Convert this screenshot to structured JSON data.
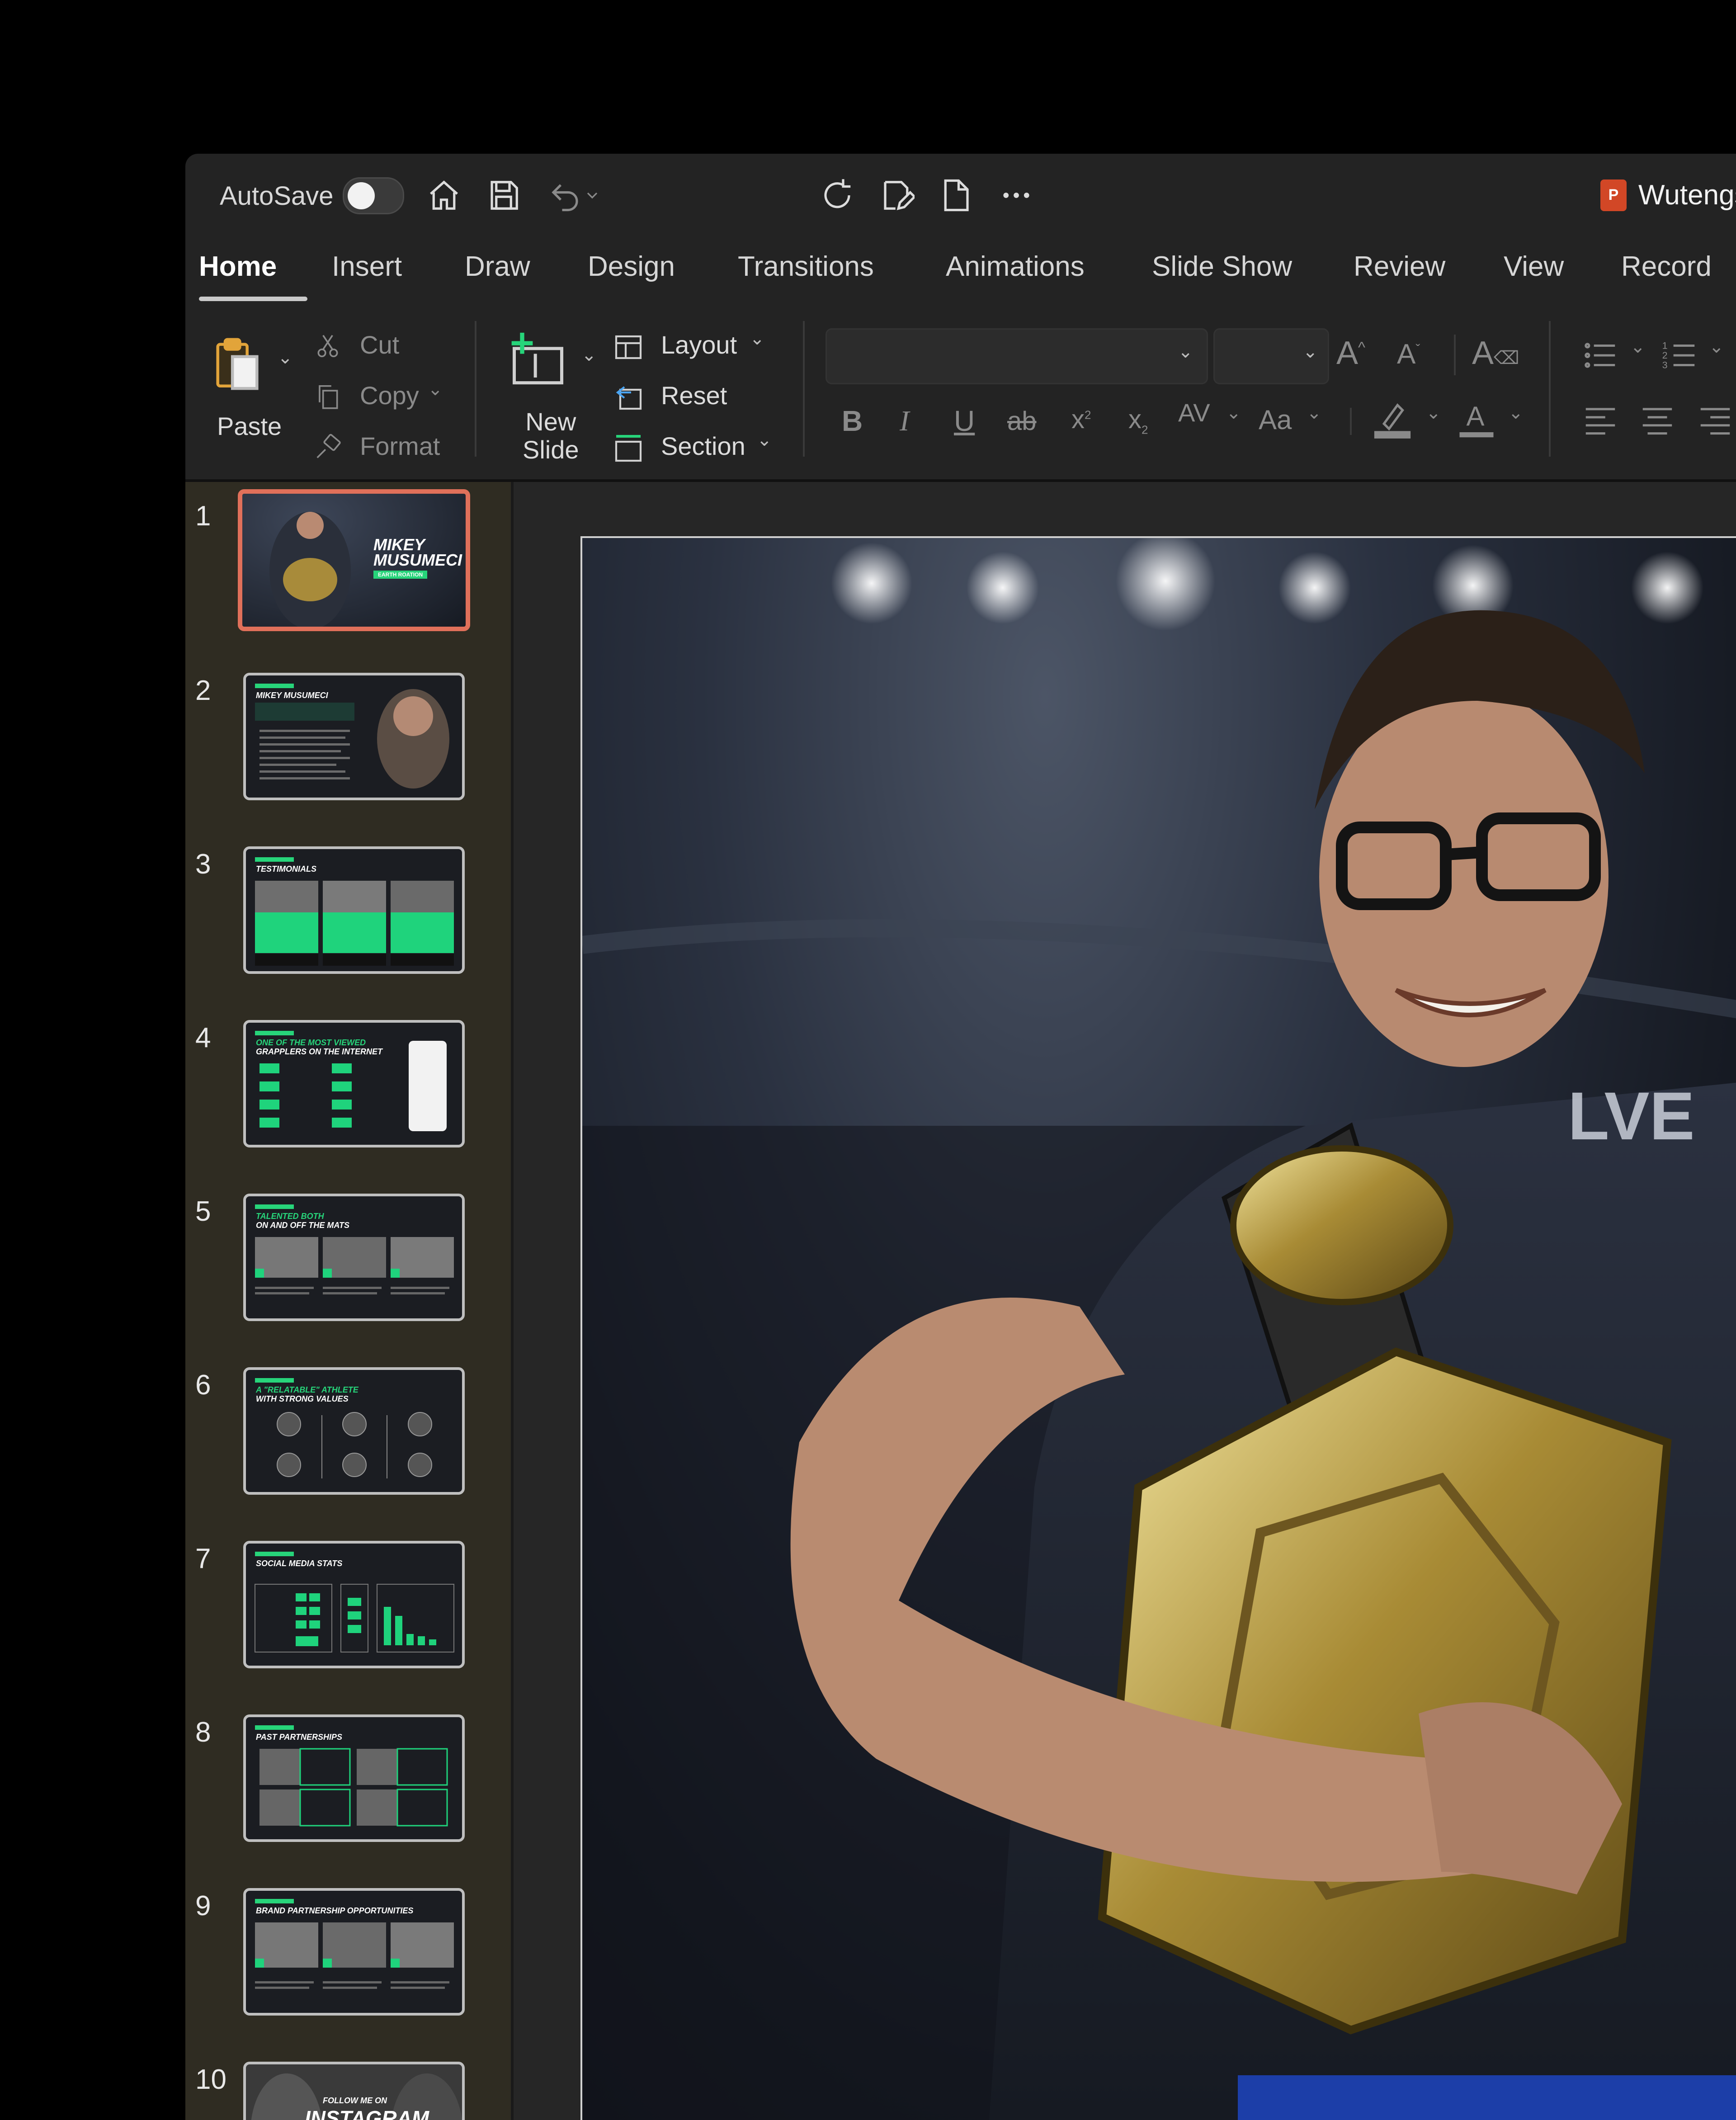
{
  "titlebar": {
    "autosave_label": "AutoSave",
    "document_title": "Wutengs_powerpoint_"
  },
  "tabs": [
    {
      "label": "Home",
      "active": true
    },
    {
      "label": "Insert"
    },
    {
      "label": "Draw"
    },
    {
      "label": "Design"
    },
    {
      "label": "Transitions"
    },
    {
      "label": "Animations"
    },
    {
      "label": "Slide Show"
    },
    {
      "label": "Review"
    },
    {
      "label": "View"
    },
    {
      "label": "Record"
    }
  ],
  "ribbon": {
    "paste": "Paste",
    "cut": "Cut",
    "copy": "Copy",
    "format": "Format",
    "new_slide_line1": "New",
    "new_slide_line2": "Slide",
    "layout": "Layout",
    "reset": "Reset",
    "section": "Section"
  },
  "slides": [
    {
      "number": "1",
      "title_line1": "MIKEY",
      "title_line2": "MUSUMECI",
      "subtitle": "EARTH ROATION"
    },
    {
      "number": "2",
      "title_line1": "MIKEY MUSUMECI"
    },
    {
      "number": "3",
      "title_line1": "TESTIMONIALS"
    },
    {
      "number": "4",
      "title_line1": "ONE OF THE MOST VIEWED",
      "title_line2": "GRAPPLERS ON THE INTERNET"
    },
    {
      "number": "5",
      "title_line1": "TALENTED BOTH",
      "title_line2": "ON AND OFF THE MATS"
    },
    {
      "number": "6",
      "title_line1": "A \"RELATABLE\" ATHLETE",
      "title_line2": "WITH STRONG VALUES"
    },
    {
      "number": "7",
      "title_line1": "SOCIAL MEDIA STATS"
    },
    {
      "number": "8",
      "title_line1": "PAST PARTNERSHIPS"
    },
    {
      "number": "9",
      "title_line1": "BRAND PARTNERSHIP OPPORTUNITIES"
    },
    {
      "number": "10",
      "title_line1": "FOLLOW ME ON",
      "title_line2": "INSTAGRAM"
    }
  ],
  "colors": {
    "accent_green": "#27d47a",
    "selection": "#e0705a",
    "ppt_red": "#d24726"
  }
}
